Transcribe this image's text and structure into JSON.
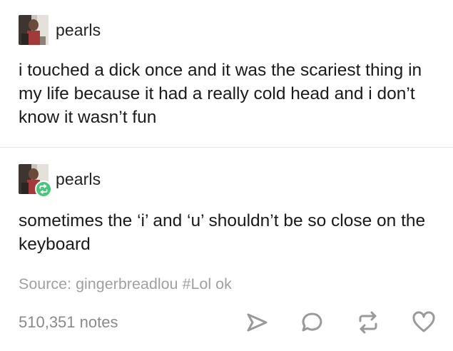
{
  "posts": [
    {
      "username": "pearls",
      "text": "i touched a dick once and it was the scariest thing in my life because it had a really cold head and i don’t know it wasn’t fun",
      "avatar": "user-avatar-photo"
    },
    {
      "username": "pearls",
      "text": "sometimes the ‘i’ and ‘u’ shouldn’t be so close on the keyboard",
      "avatar": "user-avatar-photo",
      "badge": "reblog-icon"
    }
  ],
  "source": "Source: gingerbreadlou #Lol ok",
  "footer": {
    "notes": "510,351 notes",
    "actions": [
      "share-icon",
      "reply-icon",
      "reblog-icon",
      "like-icon"
    ]
  },
  "colors": {
    "reblog_badge": "#4bc47c",
    "muted_text": "#a0a0a0",
    "icon": "#9a9a9a"
  }
}
